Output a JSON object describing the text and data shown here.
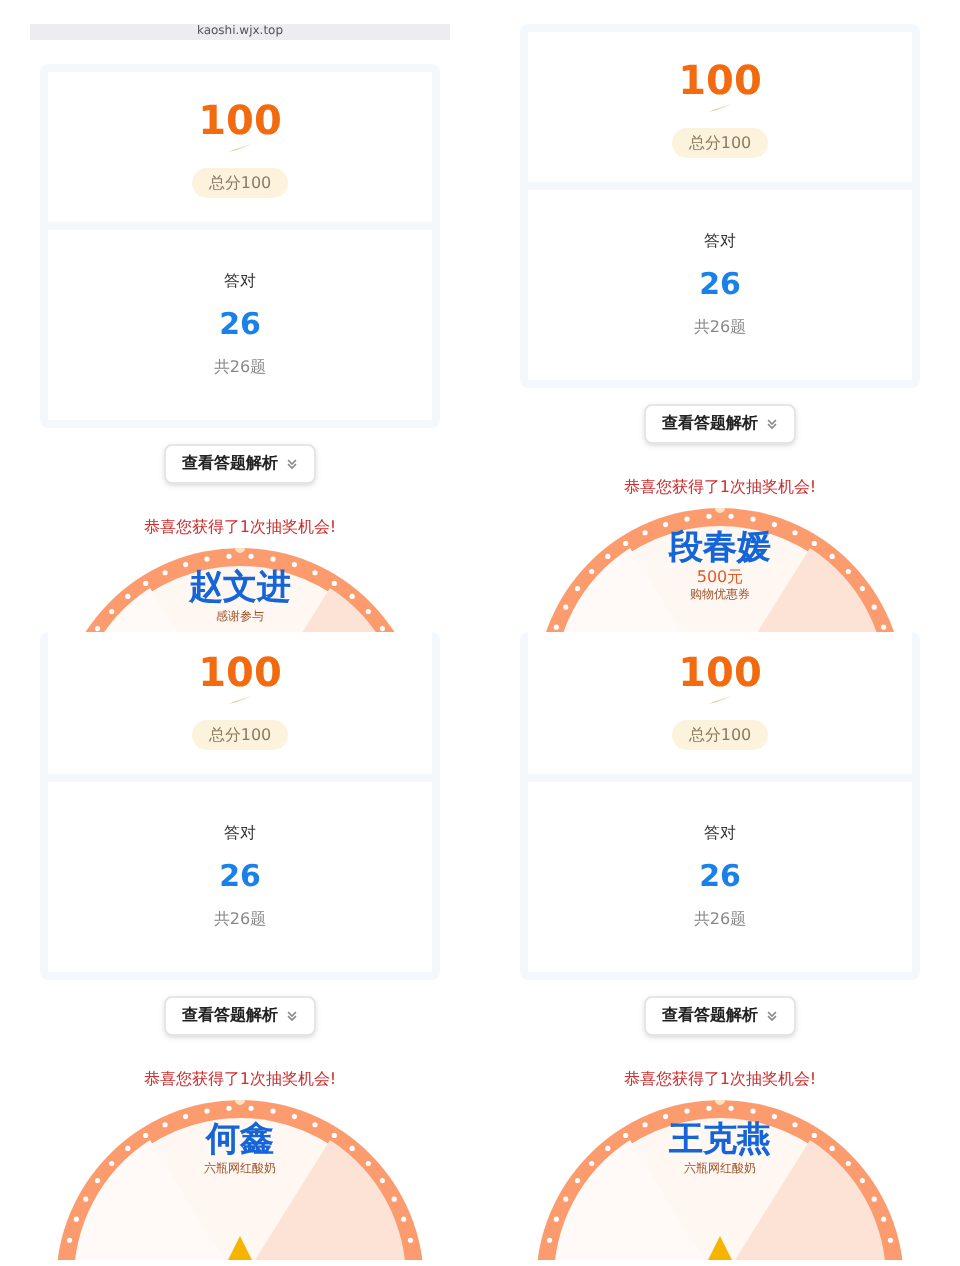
{
  "panels": [
    {
      "kind": "top",
      "url": "kaoshi.wjx.top",
      "score": "100",
      "score_total": "总分100",
      "correct_label": "答对",
      "correct": "26",
      "question_total": "共26题",
      "button": "查看答题解析",
      "congrats": "恭喜您获得了1次抽奖机会!",
      "name": "赵文进",
      "prize": "感谢参与"
    },
    {
      "kind": "top",
      "score": "100",
      "score_total": "总分100",
      "correct_label": "答对",
      "correct": "26",
      "question_total": "共26题",
      "button": "查看答题解析",
      "congrats": "恭喜您获得了1次抽奖机会!",
      "name": "段春媛",
      "prize_amount": "500元",
      "prize": "购物优惠券"
    },
    {
      "kind": "cropped",
      "score": "100",
      "score_total": "总分100",
      "correct_label": "答对",
      "correct": "26",
      "question_total": "共26题",
      "button": "查看答题解析",
      "congrats": "恭喜您获得了1次抽奖机会!",
      "name": "何鑫",
      "prize": "六瓶网红酸奶"
    },
    {
      "kind": "cropped",
      "score": "100",
      "score_total": "总分100",
      "correct_label": "答对",
      "correct": "26",
      "question_total": "共26题",
      "button": "查看答题解析",
      "congrats": "恭喜您获得了1次抽奖机会!",
      "name": "王克燕",
      "prize": "六瓶网红酸奶"
    }
  ]
}
